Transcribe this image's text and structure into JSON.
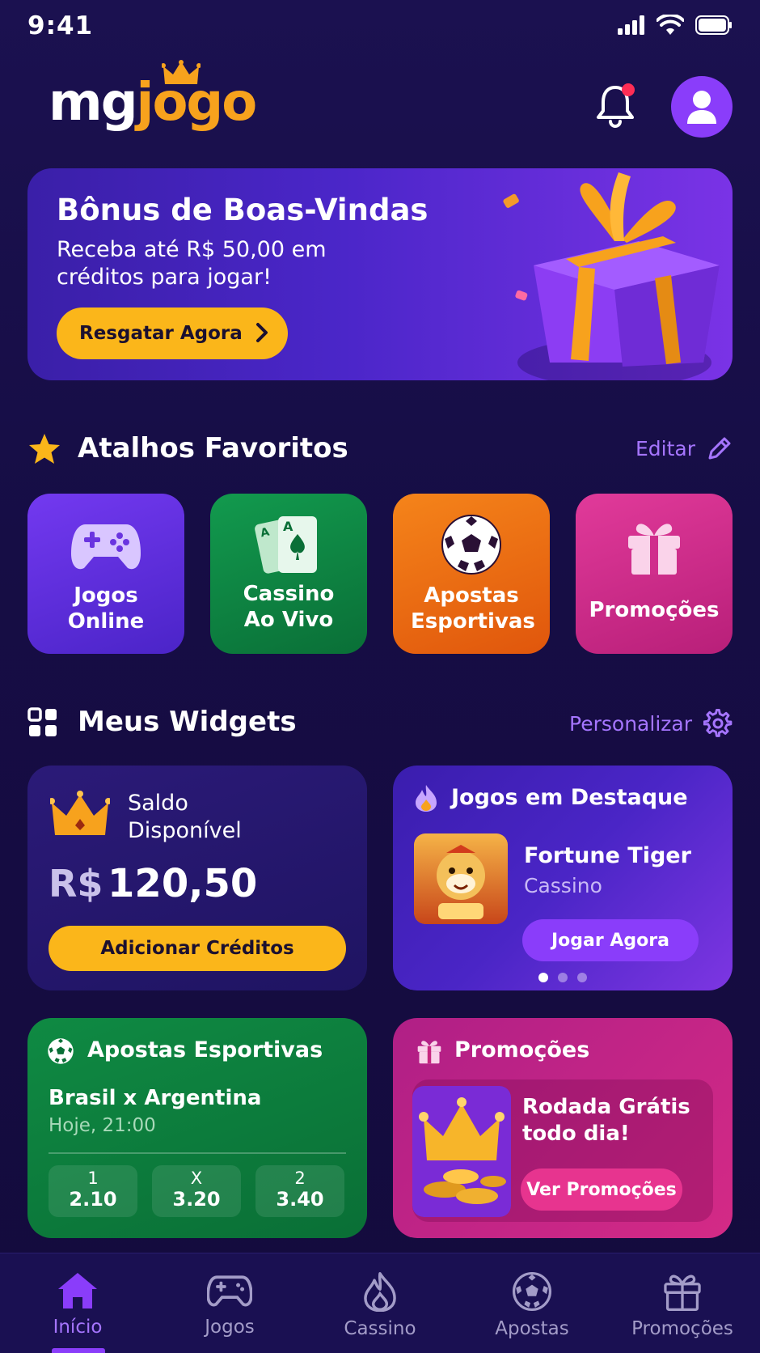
{
  "status": {
    "time": "9:41"
  },
  "header": {
    "logo_part1": "mg",
    "logo_part2": "jogo"
  },
  "banner": {
    "title": "Bônus de Boas-Vindas",
    "subtitle": "Receba até R$ 50,00 em créditos para jogar!",
    "button": "Resgatar Agora"
  },
  "shortcuts": {
    "title": "Atalhos Favoritos",
    "edit": "Editar",
    "items": [
      {
        "label": "Jogos Online",
        "color": "#5a2fd8"
      },
      {
        "label": "Cassino Ao Vivo",
        "color": "#0d8a45"
      },
      {
        "label": "Apostas Esportivas",
        "color": "#f17213"
      },
      {
        "label": "Promoções",
        "color": "#d02e8c"
      }
    ]
  },
  "widgets": {
    "title": "Meus Widgets",
    "customize": "Personalizar",
    "saldo": {
      "label": "Saldo Disponível",
      "currency": "R$",
      "amount": "120,50",
      "button": "Adicionar Créditos"
    },
    "destaque": {
      "title": "Jogos em Destaque",
      "game": "Fortune Tiger",
      "category": "Cassino",
      "button": "Jogar Agora"
    },
    "apostas": {
      "title": "Apostas Esportivas",
      "match": "Brasil x Argentina",
      "when": "Hoje, 21:00",
      "odds": [
        {
          "key": "1",
          "value": "2.10"
        },
        {
          "key": "X",
          "value": "3.20"
        },
        {
          "key": "2",
          "value": "3.40"
        }
      ]
    },
    "promocoes": {
      "title": "Promoções",
      "headline": "Rodada Grátis todo dia!",
      "button": "Ver Promoções"
    }
  },
  "nav": {
    "items": [
      {
        "label": "Início",
        "icon": "home-icon",
        "active": true
      },
      {
        "label": "Jogos",
        "icon": "gamepad-icon"
      },
      {
        "label": "Cassino",
        "icon": "flame-icon"
      },
      {
        "label": "Apostas",
        "icon": "soccer-ball-icon"
      },
      {
        "label": "Promoções",
        "icon": "gift-icon"
      }
    ]
  },
  "colors": {
    "accent": "#8a3dfa",
    "link": "#a575ff",
    "yellow": "#fbb61a",
    "background": "#170f45"
  }
}
